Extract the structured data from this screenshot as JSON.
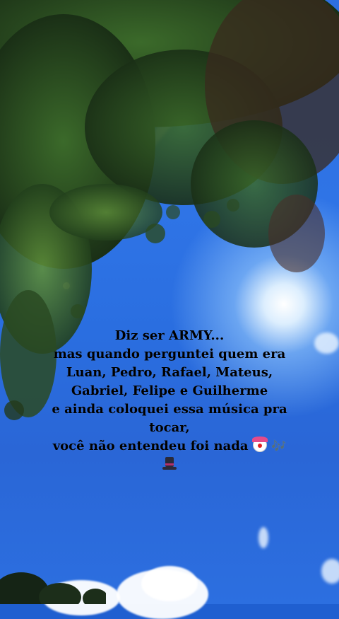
{
  "story": {
    "caption_lines": [
      "Diz ser ARMY...",
      "mas quando perguntei quem era",
      "Luan, Pedro, Rafael, Mateus,",
      "Gabriel, Felipe e Guilherme",
      "e ainda coloquei essa música pra",
      "tocar,",
      "você não entendeu foi nada"
    ],
    "emojis": [
      "clown-face-icon",
      "musical-notes-icon",
      "top-hat-icon"
    ],
    "notes_glyph": "🎶",
    "colors": {
      "sky": "#2e6fe0",
      "foliage": "#1f3a1e",
      "text": "#000000"
    }
  }
}
